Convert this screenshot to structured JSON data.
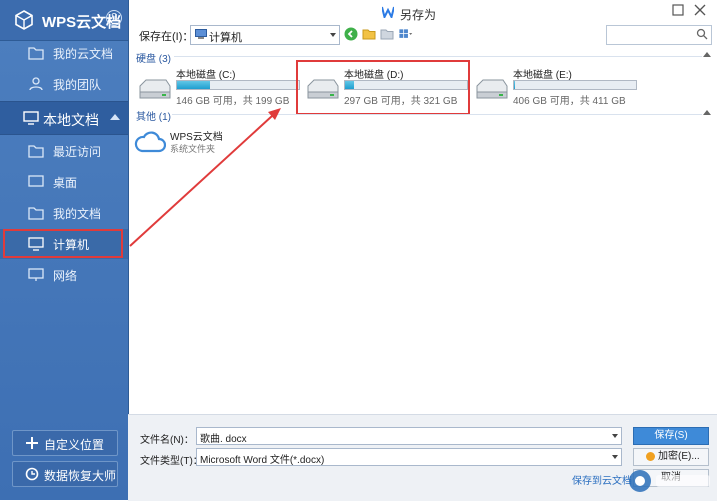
{
  "sidebar": {
    "brand": "WPS云文档",
    "help": "?",
    "items_top": [
      {
        "label": "我的云文档"
      },
      {
        "label": "我的团队"
      }
    ],
    "section": "本地文档",
    "items_local": [
      {
        "label": "最近访问"
      },
      {
        "label": "桌面"
      },
      {
        "label": "我的文档"
      },
      {
        "label": "计算机"
      },
      {
        "label": "网络"
      }
    ],
    "buttons": {
      "custom_location": "自定义位置",
      "data_recovery": "数据恢复大师"
    }
  },
  "dialog": {
    "title": "另存为",
    "save_in_label": "保存在(I)：",
    "location": "计算机",
    "search_placeholder": ""
  },
  "groups": {
    "disks_header": "硬盘 (3)",
    "other_header": "其他 (1)"
  },
  "drives": [
    {
      "name": "本地磁盘 (C:)",
      "info": "146 GB 可用，共 199 GB",
      "used_fraction": 0.27
    },
    {
      "name": "本地磁盘 (D:)",
      "info": "297 GB 可用，共 321 GB",
      "used_fraction": 0.07
    },
    {
      "name": "本地磁盘 (E:)",
      "info": "406 GB 可用，共 411 GB",
      "used_fraction": 0.01
    }
  ],
  "cloud": {
    "name": "WPS云文档",
    "sub": "系统文件夹"
  },
  "bottom": {
    "filename_label": "文件名(N)：",
    "filename_value": "歌曲. docx",
    "filetype_label": "文件类型(T)：",
    "filetype_value": "Microsoft Word 文件(*.docx)",
    "save_button": "保存(S)",
    "encrypt_button": "加密(E)...",
    "save_to_cloud": "保存到云文档",
    "cancel_button": "取消"
  },
  "colors": {
    "sidebar_bg": "#4474b6",
    "accent": "#3e8ad8",
    "highlight": "#e03b3b",
    "drive_fill": "#1f9ed0"
  }
}
